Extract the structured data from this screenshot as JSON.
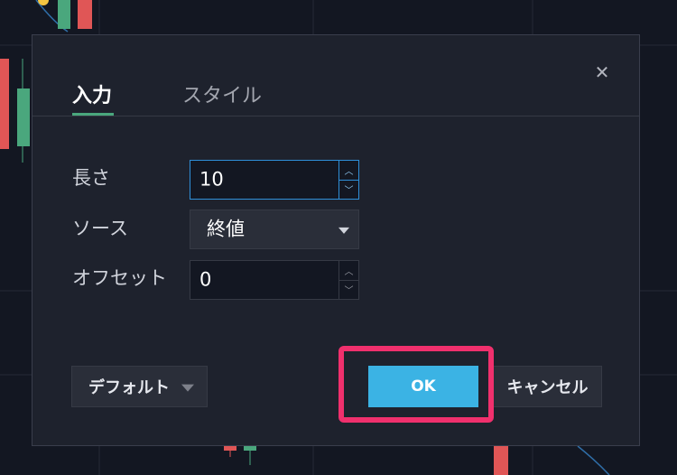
{
  "dialog": {
    "tabs": [
      {
        "label": "入力",
        "active": true
      },
      {
        "label": "スタイル",
        "active": false
      }
    ],
    "close_glyph": "✕",
    "fields": {
      "length": {
        "label": "長さ",
        "value": "10"
      },
      "source": {
        "label": "ソース",
        "value": "終値"
      },
      "offset": {
        "label": "オフセット",
        "value": "0"
      }
    },
    "buttons": {
      "default_label": "デフォルト",
      "ok_label": "OK",
      "cancel_label": "キャンセル"
    }
  },
  "colors": {
    "accent_blue": "#3bb3e4",
    "tab_underline": "#4aa77d",
    "highlight": "#f0306d",
    "candle_up": "#4aa77d",
    "candle_down": "#e05656"
  }
}
